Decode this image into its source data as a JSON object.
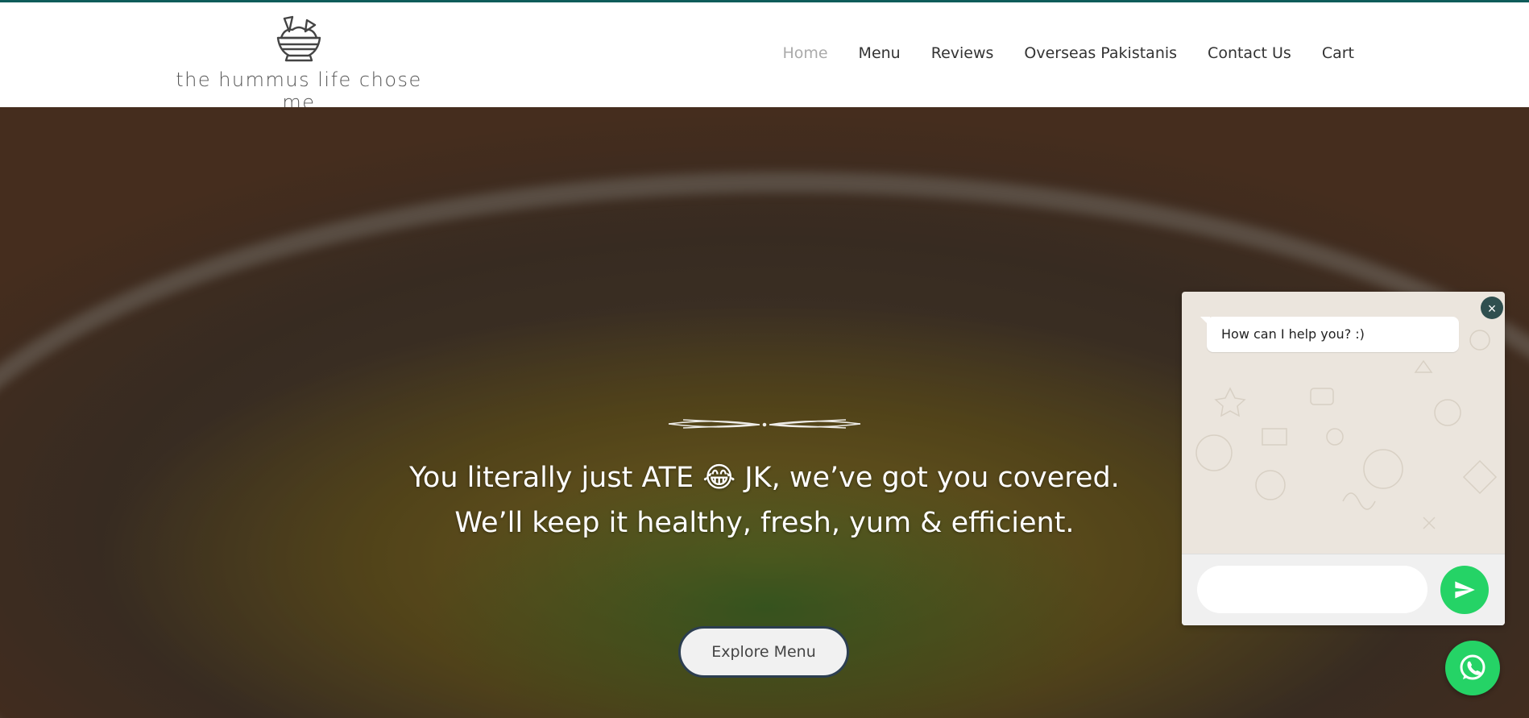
{
  "header": {
    "logo_text": "the hummus life chose me",
    "nav": [
      {
        "label": "Home",
        "active": true
      },
      {
        "label": "Menu",
        "active": false
      },
      {
        "label": "Reviews",
        "active": false
      },
      {
        "label": "Overseas Pakistanis",
        "active": false
      },
      {
        "label": "Contact Us",
        "active": false
      },
      {
        "label": "Cart",
        "active": false
      }
    ]
  },
  "hero": {
    "line1": "You literally just ATE 😂 JK, we’ve got you covered.",
    "line2": "We’ll keep it healthy, fresh, yum & efficient.",
    "cta_label": "Explore Menu"
  },
  "chat": {
    "greeting": "How can I help you? :)",
    "input_placeholder": "",
    "close_label": "×"
  },
  "colors": {
    "accent_bar": "#0f5c5a",
    "whatsapp": "#25d366",
    "nav_active": "#aaaaaa"
  },
  "icons": {
    "logo": "hummus-bowl-icon",
    "send": "send-icon",
    "whatsapp": "whatsapp-icon",
    "close": "close-icon"
  }
}
